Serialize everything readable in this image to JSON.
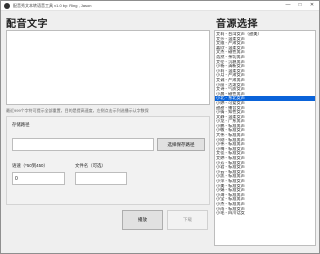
{
  "window": {
    "title": "配音秀文本转语音工具 v1.0 by: Ring , Jason",
    "minimize": "—",
    "maximize": "□",
    "close": "✕"
  },
  "left": {
    "heading": "配音文字",
    "text_value": "",
    "hint": "最近999个字符可提示全部重置，目的是提高速度，左侧点击示列选播示认字数保"
  },
  "save": {
    "group_label": "存储路径",
    "path_value": "",
    "browse_button": "选择保存路径",
    "speed_label": "语速（*50到450）",
    "speed_value": "0",
    "filename_label": "文件名（可选）",
    "filename_value": ""
  },
  "actions": {
    "play_button": "播放",
    "download_button": "下载"
  },
  "right": {
    "heading": "音源选择",
    "selected_index": 14,
    "items": [
      "艾莉 - 台湾女声（甜美）",
      "艾莎 - 温柔女声",
      "艾维 - 严肃女声",
      "嘉欣 - 温柔女声",
      "文杰 - 磁性男声",
      "浩然 - 亲切男声",
      "艾伦 - 沉稳男声",
      "小杨 - 清新女声",
      "小莉 - 温柔女声",
      "小月 - 严肃女声",
      "艾诚 - 严肃男声",
      "小丽 - 活泼女声",
      "艾诗 - 气质女声",
      "小晨 - 磁性男声",
      "小北 - 东北女声",
      "小婷 - 可爱女声",
      "甜甜 - 播音女声",
      "小倩 - 知性女声",
      "文静 - 温柔女声",
      "小龙 - 广东男声",
      "小鹏 - 标准男声",
      "小敏 - 标准女声",
      "大伟 - 标准男声",
      "小刚 - 标准男声",
      "小伟 - 标准男声",
      "小梅 - 标准女声",
      "艾佳 - 标准女声",
      "艾婷 - 标准女声",
      "小芳 - 标准女声",
      "小君 - 标准女声",
      "小云 - 标准女声",
      "小凯 - 标准男声",
      "小萍 - 标准女声",
      "小美 - 标准女声",
      "小娟 - 标准女声",
      "小海 - 标准男声",
      "小宝 - 标准男声",
      "小杰 - 标准男声",
      "小雨 - 标准女声",
      "小毛 - 四川话女"
    ]
  }
}
